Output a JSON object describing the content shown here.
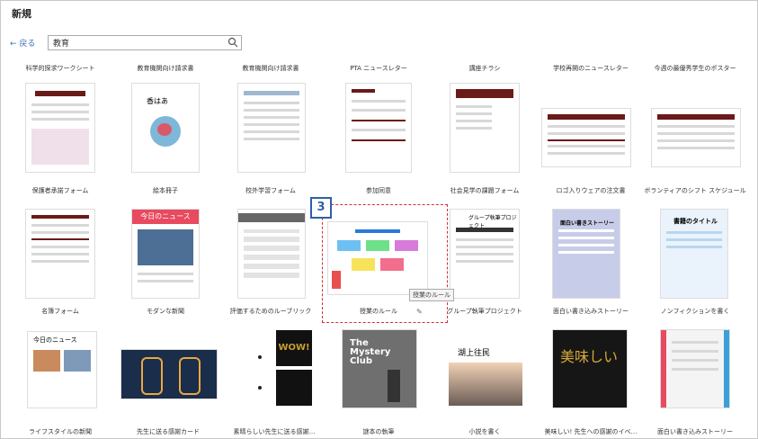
{
  "window": {
    "title": "新規"
  },
  "nav": {
    "back_label": "← 戻る"
  },
  "search": {
    "value": "教育",
    "icon": "search-icon"
  },
  "headers": [
    "科学的探求ワークシート",
    "教育機関向け請求書",
    "教育機関向け請求書",
    "PTA ニュースレター",
    "講座チラシ",
    "学校再開のニュースレター",
    "今週の最優秀学生のポスター"
  ],
  "row1": [
    "保護者承諾フォーム",
    "絵本冊子",
    "校外学習フォーム",
    "参加同意",
    "社会見学の課題フォーム",
    "ロゴ入りウェアの注文書",
    "ボランティアのシフト スケジュール"
  ],
  "row2": [
    "名簿フォーム",
    "モダンな新聞",
    "評価するためのルーブリック",
    "授業のルール",
    "グループ執筆プロジェクト",
    "面白い書き込みストーリー",
    "ノンフィクションを書く"
  ],
  "row3": [
    "ライフスタイルの新聞",
    "先生に送る感謝カード",
    "素晴らしい先生に送る感謝…",
    "謎本の執筆",
    "小説を書く",
    "美味しい! 先生への感謝のイベ…",
    "面白い書き込みストーリー"
  ],
  "thumb_text": {
    "t_flower": "香はあ",
    "t_news": "今日のニュース",
    "t_group": "グループ執筆プロジェクト",
    "t_story": "面白い書きストーリー",
    "t_nonfic": "書籍のタイトル",
    "t_news2": "今日のニュース",
    "t_wow": "WOW!",
    "t_mystery_1": "The",
    "t_mystery_2": "Mystery",
    "t_mystery_3": "Club",
    "t_novel": "湖上往民",
    "t_oishii": "美味しい"
  },
  "callout": {
    "badge": "3",
    "tooltip": "授業のルール"
  },
  "colors": {
    "accent": "#2f5fa8",
    "callout": "#d23030",
    "dark_red": "#6b1a1a"
  }
}
